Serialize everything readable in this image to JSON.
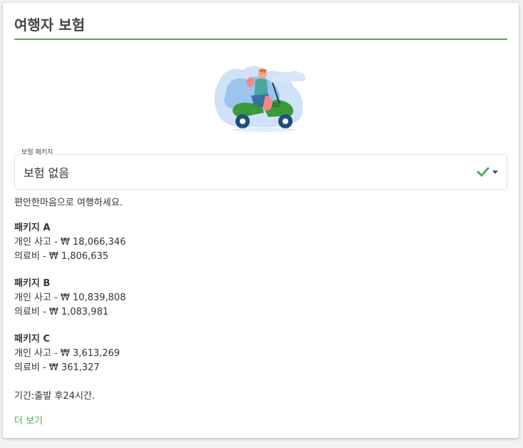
{
  "title": "여행자 보험",
  "select": {
    "label": "보험 패키지",
    "value": "보험 없음"
  },
  "description": "편안한마음으로 여행하세요.",
  "packages": [
    {
      "name": "패키지 A",
      "accident": "개인 사고 - ₩ 18,066,346",
      "medical": "의료비 - ₩ 1,806,635"
    },
    {
      "name": "패키지 B",
      "accident": "개인 사고 - ₩ 10,839,808",
      "medical": "의료비 - ₩ 1,083,981"
    },
    {
      "name": "패키지 C",
      "accident": "개인 사고 - ₩ 3,613,269",
      "medical": "의료비 - ₩ 361,327"
    }
  ],
  "duration": "기간:출발 후24시간.",
  "more_link": "더 보기",
  "colors": {
    "accent": "#4caf50",
    "scooter": "#3a9a3a",
    "wheel": "#1e4f7a"
  },
  "icons": {
    "check": "check-icon",
    "caret": "caret-down-icon",
    "illustration": "scooter-rider-illustration"
  }
}
